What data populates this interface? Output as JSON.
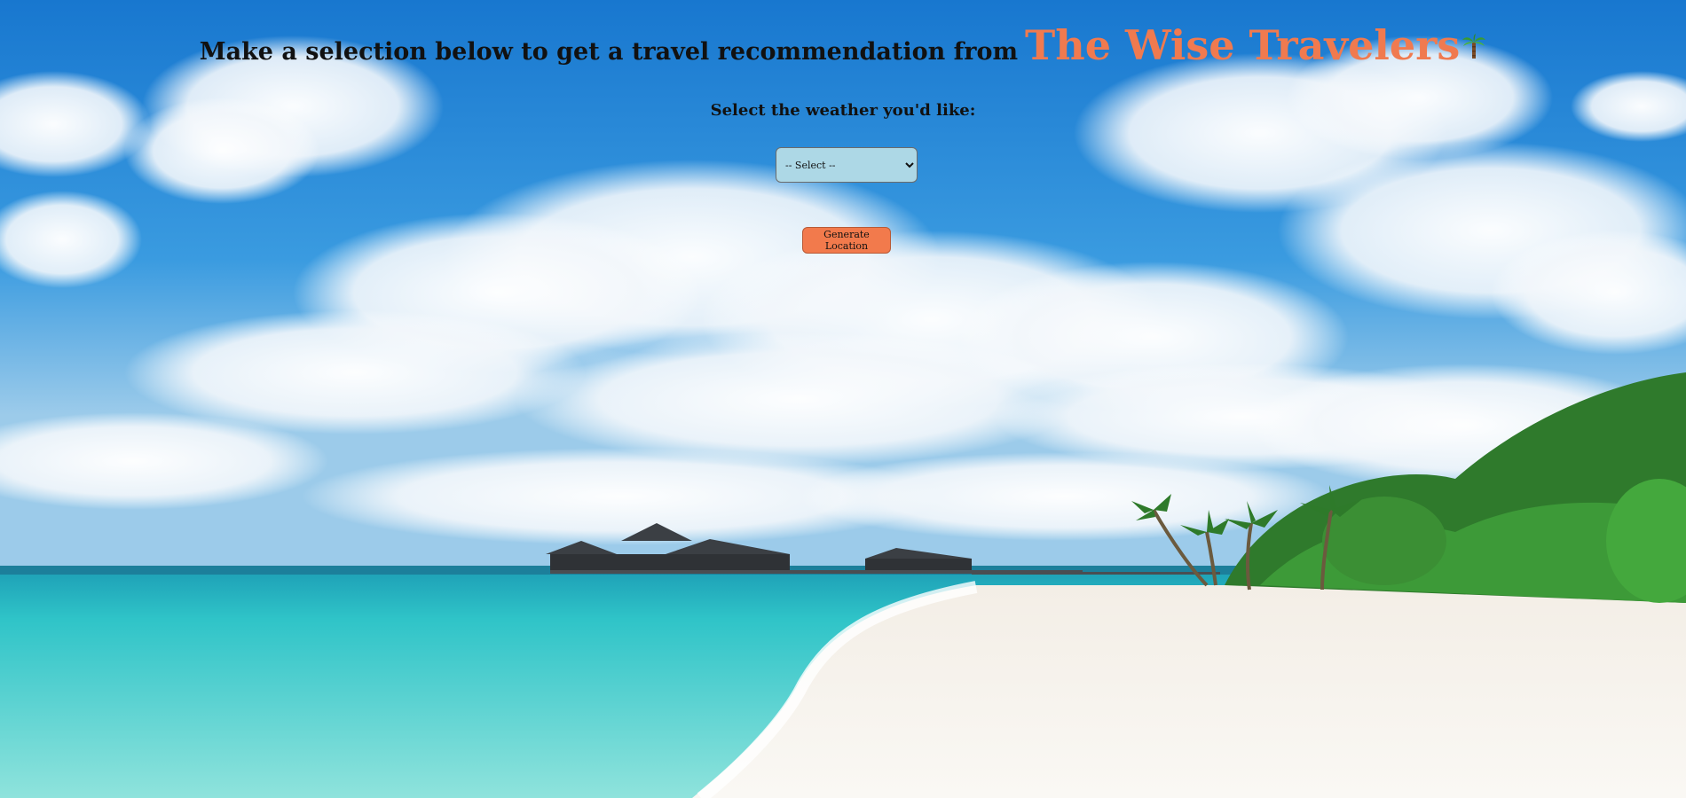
{
  "header": {
    "lead_text": "Make a selection below to get a travel recommendation from",
    "brand_name": "The Wise Travelers",
    "brand_icon": "palm-tree-icon",
    "brand_color": "#f07a4f"
  },
  "form": {
    "weather_label": "Select the weather you'd like:",
    "weather_select": {
      "selected": "-- Select --",
      "options": [
        "-- Select --"
      ]
    },
    "generate_button_label": "Generate Location"
  },
  "background": {
    "sky_color": "#1f86d8",
    "sea_color": "#36c9cc",
    "sand_color": "#f5f1ea",
    "button_color": "#f27a4c",
    "select_color": "#add8e6"
  }
}
